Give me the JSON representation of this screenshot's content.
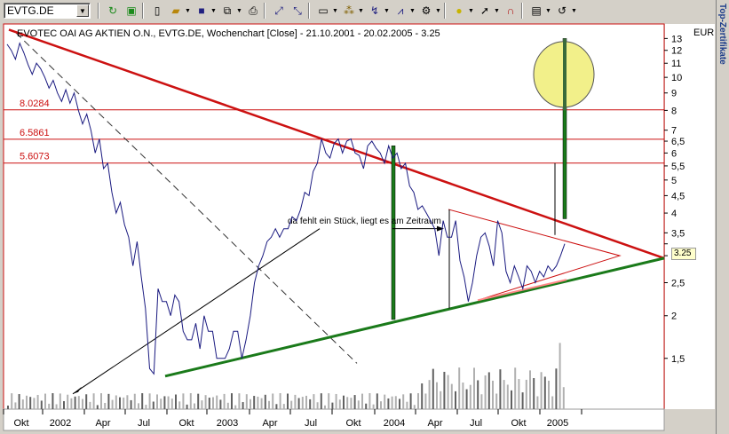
{
  "toolbar": {
    "symbol": "EVTG.DE",
    "buttons": [
      "refresh-icon",
      "chart-icon",
      "new-icon",
      "open-icon",
      "save-icon",
      "copy-icon",
      "print-icon",
      "line-tool-icon",
      "zoom-icon",
      "chart-type-icon",
      "indicator-icon",
      "template-icon",
      "ellipse-tool-icon",
      "cursor-icon",
      "magnet-icon",
      "properties-icon",
      "undo-icon"
    ]
  },
  "side_tab": {
    "label": "Top-Zertifikate"
  },
  "chart": {
    "title": "EVOTEC OAI AG AKTIEN O.N., EVTG.DE, Wochenchart [Close] - 21.10.2001 - 20.02.2005 - 3.25",
    "currency": "EUR",
    "current_price": "3.25",
    "annotation": "da fehlt ein Stück, liegt es am Zeitraum",
    "level_labels": [
      "8.0284",
      "6.5861",
      "5.6073"
    ],
    "colors": {
      "price_line": "#1a1a80",
      "trend_red": "#cc1111",
      "trend_green": "#1a7a1a",
      "circle": "#f2f08a"
    }
  },
  "chart_data": {
    "type": "line",
    "title": "EVOTEC OAI AG AKTIEN O.N., EVTG.DE, Wochenchart [Close] - 21.10.2001 - 20.02.2005 - 3.25",
    "y_scale": "log",
    "ylim": [
      1.2,
      14
    ],
    "y_ticks": [
      13,
      12,
      11,
      10,
      9,
      8,
      7,
      6.5,
      6,
      5.5,
      5,
      4.5,
      4,
      3.5,
      3,
      2.5,
      2,
      1.5
    ],
    "x_ticks": [
      "Okt",
      "2002",
      "Apr",
      "Jul",
      "Okt",
      "2003",
      "Apr",
      "Jul",
      "Okt",
      "2004",
      "Apr",
      "Jul",
      "Okt",
      "2005"
    ],
    "horizontal_levels": [
      8.0284,
      6.5861,
      5.6073
    ],
    "series": [
      {
        "values": [
          12.5,
          12.0,
          11.3,
          12.6,
          11.8,
          10.9,
          10.2,
          11.0,
          10.6,
          10.0,
          9.3,
          9.8,
          9.0,
          8.5,
          9.2,
          8.4,
          9.0,
          8.0,
          7.3,
          7.8,
          7.0,
          6.0,
          6.6,
          5.4,
          5.6,
          4.6,
          4.0,
          4.3,
          3.7,
          3.4,
          2.8,
          3.3,
          2.6,
          2.1,
          1.4,
          1.35,
          2.4,
          2.2,
          2.2,
          2.0,
          2.3,
          2.2,
          1.8,
          1.7,
          1.7,
          1.9,
          1.6,
          2.0,
          1.8,
          1.8,
          1.5,
          1.5,
          1.5,
          1.6,
          1.8,
          1.8,
          1.5,
          1.7,
          2.0,
          2.5,
          2.8,
          3.0,
          3.3,
          3.4,
          3.6,
          3.4,
          3.6,
          3.6,
          3.9,
          3.8,
          4.1,
          4.6,
          4.5,
          5.3,
          5.6,
          6.6,
          6.0,
          5.8,
          6.4,
          6.6,
          6.0,
          6.5,
          6.6,
          6.0,
          5.9,
          5.4,
          6.3,
          6.5,
          6.2,
          6.0,
          5.6,
          6.3,
          5.8,
          6.0,
          5.4,
          5.6,
          4.8,
          4.6,
          4.1,
          4.2,
          4.0,
          3.8,
          3.6,
          3.0,
          3.8,
          3.4,
          3.4,
          3.8,
          2.9,
          2.6,
          2.2,
          2.5,
          3.0,
          3.4,
          3.5,
          3.2,
          2.8,
          3.8,
          3.5,
          2.7,
          2.5,
          2.8,
          2.6,
          2.4,
          2.8,
          2.7,
          2.5,
          2.7,
          2.6,
          2.8,
          2.7,
          2.8,
          3.0,
          3.25
        ]
      }
    ]
  }
}
